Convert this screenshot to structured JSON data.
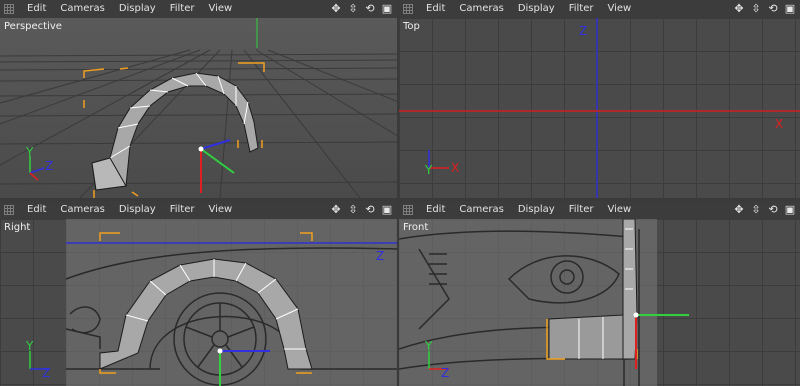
{
  "menus": [
    "Edit",
    "Cameras",
    "Display",
    "Filter",
    "View"
  ],
  "viewports": {
    "perspective": {
      "label": "Perspective"
    },
    "top": {
      "label": "Top",
      "axis_z": "Z",
      "axis_x": "X"
    },
    "right": {
      "label": "Right",
      "axis_z": "Z"
    },
    "front": {
      "label": "Front"
    }
  },
  "icons": [
    "move-view-icon",
    "dolly-icon",
    "rotate-view-icon",
    "maximize-icon"
  ],
  "colors": {
    "axis_x": "#e02020",
    "axis_y": "#30d040",
    "axis_z": "#3030e0",
    "selection": "#f0a020"
  }
}
